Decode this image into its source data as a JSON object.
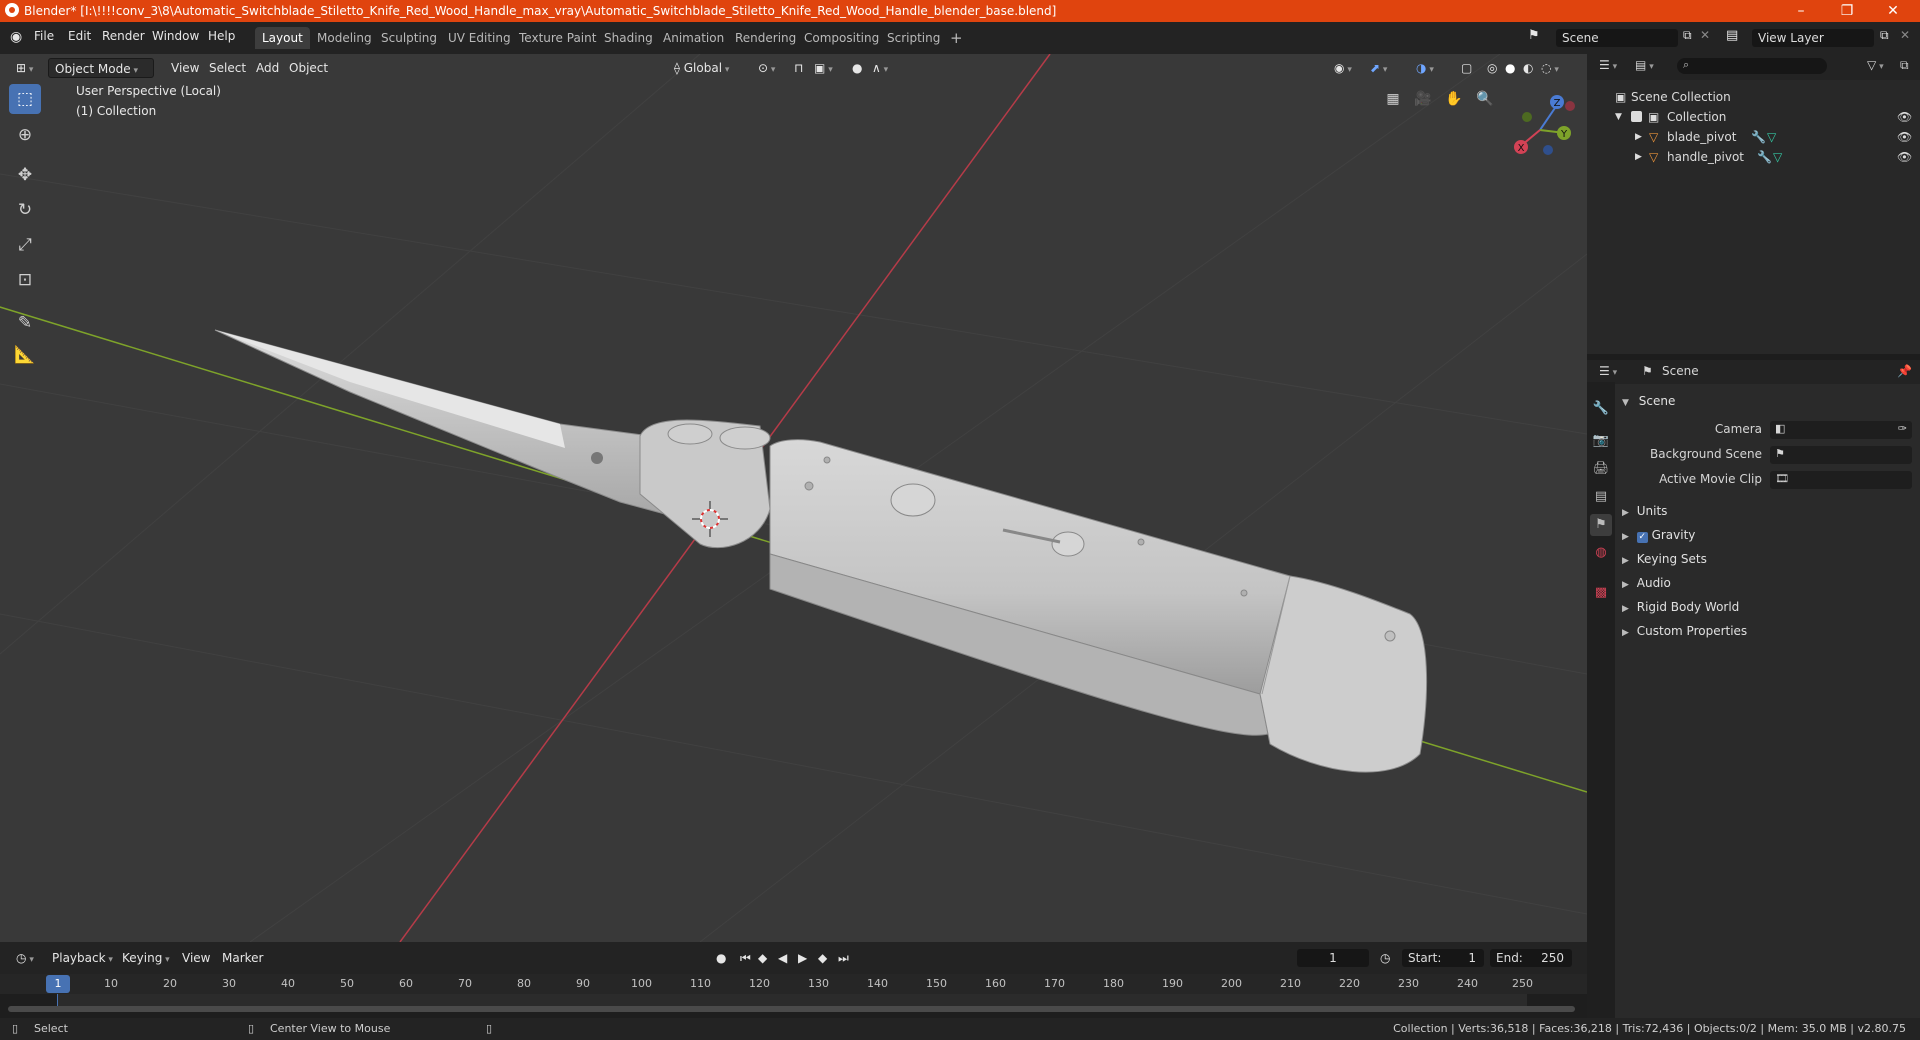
{
  "window": {
    "title": "Blender* [I:\\!!!!conv_3\\8\\Automatic_Switchblade_Stiletto_Knife_Red_Wood_Handle_max_vray\\Automatic_Switchblade_Stiletto_Knife_Red_Wood_Handle_blender_base.blend]",
    "minimize": "–",
    "maximize": "❐",
    "close": "✕"
  },
  "menu": {
    "items": [
      "File",
      "Edit",
      "Render",
      "Window",
      "Help"
    ],
    "workspaces": [
      "Layout",
      "Modeling",
      "Sculpting",
      "UV Editing",
      "Texture Paint",
      "Shading",
      "Animation",
      "Rendering",
      "Compositing",
      "Scripting"
    ],
    "active_workspace": "Layout",
    "add_tab": "+",
    "scene_name": "Scene",
    "view_layer": "View Layer"
  },
  "viewport": {
    "mode": "Object Mode",
    "menus": [
      "View",
      "Select",
      "Add",
      "Object"
    ],
    "orientation": "Global",
    "perspective_label": "User Perspective (Local)",
    "collection_label": "(1) Collection",
    "gizmo": {
      "x": "X",
      "y": "Y",
      "z": "Z"
    }
  },
  "outliner": {
    "root": "Scene Collection",
    "collection": "Collection",
    "objects": [
      "blade_pivot",
      "handle_pivot"
    ]
  },
  "properties": {
    "context": "Scene",
    "panel_title": "Scene",
    "fields": [
      {
        "label": "Camera"
      },
      {
        "label": "Background Scene"
      },
      {
        "label": "Active Movie Clip"
      }
    ],
    "subpanels": [
      "Units",
      "Gravity",
      "Keying Sets",
      "Audio",
      "Rigid Body World",
      "Custom Properties"
    ],
    "gravity_checked": true
  },
  "timeline": {
    "menus": [
      "Playback",
      "Keying",
      "View",
      "Marker"
    ],
    "current_frame": "1",
    "start_label": "Start:",
    "start": "1",
    "end_label": "End:",
    "end": "250",
    "ticks": [
      "1",
      "10",
      "20",
      "30",
      "40",
      "50",
      "60",
      "70",
      "80",
      "90",
      "100",
      "110",
      "120",
      "130",
      "140",
      "150",
      "160",
      "170",
      "180",
      "190",
      "200",
      "210",
      "220",
      "230",
      "240",
      "250"
    ]
  },
  "status": {
    "select": "Select",
    "center_view": "Center View to Mouse",
    "stats": "Collection | Verts:36,518 | Faces:36,218 | Tris:72,436 | Objects:0/2 | Mem: 35.0 MB | v2.80.75"
  },
  "colors": {
    "title_bar": "#e0440e",
    "accent": "#4772b3",
    "viewport_bg": "#393939",
    "x_axis": "#b53b48",
    "y_axis": "#7ea32a"
  }
}
